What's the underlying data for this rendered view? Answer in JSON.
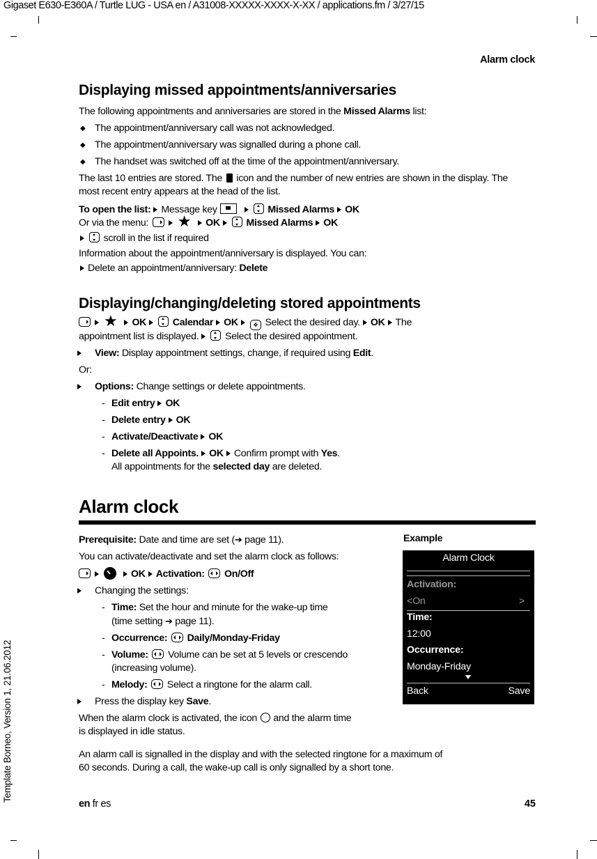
{
  "header": {
    "file_line": "Gigaset E630-E360A / Turtle LUG - USA en / A31008-XXXXX-XXXX-X-XX / applications.fm / 3/27/15",
    "running_head": "Alarm clock"
  },
  "side_label": "Template Borneo, Version 1, 21.06.2012",
  "section1": {
    "title": "Displaying missed appointments/anniversaries",
    "intro_pre": "The following appointments and anniversaries are stored in the ",
    "intro_bold": "Missed Alarms",
    "intro_post": " list:",
    "bullets": [
      "The appointment/anniversary call was not acknowledged.",
      "The appointment/anniversary was signalled during a phone call.",
      "The handset was switched off at the time of the appointment/anniversary."
    ],
    "stored_pre": "The last 10 entries are stored. The ",
    "stored_post": " icon and the number of new entries are shown in the display. The most recent entry appears at the head of the list.",
    "open_label": "To open the list:",
    "message_key": "Message key",
    "missed_alarms": "Missed Alarms",
    "ok": "OK",
    "via_menu": "Or via the menu:",
    "scroll": "scroll in the list if required",
    "info": "Information about the appointment/anniversary is displayed. You can:",
    "delete_pre": "Delete an appointment/anniversary: ",
    "delete_bold": "Delete"
  },
  "section2": {
    "title": "Displaying/changing/deleting stored appointments",
    "ok": "OK",
    "calendar": "Calendar",
    "select_day": "Select the desired day.",
    "the": "The",
    "list_displayed": "appointment list is displayed.",
    "select_appt": "Select the desired appointment.",
    "view_bold": "View:",
    "view_text": " Display appointment settings, change, if required using ",
    "edit": "Edit",
    "or": "Or:",
    "options_bold": "Options:",
    "options_text": " Change settings or delete appointments.",
    "sub_items": [
      {
        "label": "Edit entry",
        "ok": "OK"
      },
      {
        "label": "Delete entry",
        "ok": "OK"
      },
      {
        "label": "Activate/Deactivate",
        "ok": "OK"
      },
      {
        "label": "Delete all Appoints.",
        "ok": "OK",
        "confirm_pre": "Confirm prompt with ",
        "confirm_bold": "Yes",
        "note_pre": "All appointments for the ",
        "note_bold": "selected day",
        "note_post": " are deleted."
      }
    ]
  },
  "chapter": {
    "title": "Alarm clock",
    "prereq_bold": "Prerequisite:",
    "prereq_text": " Date and time are set (",
    "prereq_page": " page 11).",
    "activate_intro": "You can activate/deactivate and set the alarm clock as follows:",
    "ok": "OK",
    "activation": "Activation:",
    "onoff": "On/Off",
    "changing": "Changing the settings:",
    "settings": [
      {
        "label": "Time:",
        "text": "  Set the hour and minute for the wake-up time",
        "text2": "(time setting ",
        "text2_page": " page 11)."
      },
      {
        "label": "Occurrence:",
        "bold_value": "Daily/Monday-Friday"
      },
      {
        "label": "Volume:",
        "text": " Volume can be set at 5 levels or crescendo",
        "text2": "(increasing volume)."
      },
      {
        "label": "Melody:",
        "text": " Select a ringtone for the alarm call."
      }
    ],
    "press_pre": "Press the display key ",
    "press_bold": "Save",
    "activated_pre": "When the alarm clock is activated, the icon ",
    "activated_post": " and the alarm time",
    "activated_line2": "is displayed in idle status.",
    "signal_line1": "An alarm call is signalled in the display and with the selected ringtone for a maximum of",
    "signal_line2": "60 seconds. During a call, the wake-up call is only signalled by a short tone."
  },
  "example": {
    "label": "Example",
    "screen_title": "Alarm Clock",
    "activation_label": "Activation:",
    "activation_value": "<On",
    "activation_arrow": ">",
    "time_label": "Time:",
    "time_value": "12:00",
    "occurrence_label": "Occurrence:",
    "occurrence_value": "Monday-Friday",
    "softkey_left": "Back",
    "softkey_right": "Save"
  },
  "footer": {
    "lang_current": "en",
    "lang_others": " fr es",
    "page_number": "45"
  },
  "icons": {
    "arrow_ref": "➔"
  }
}
